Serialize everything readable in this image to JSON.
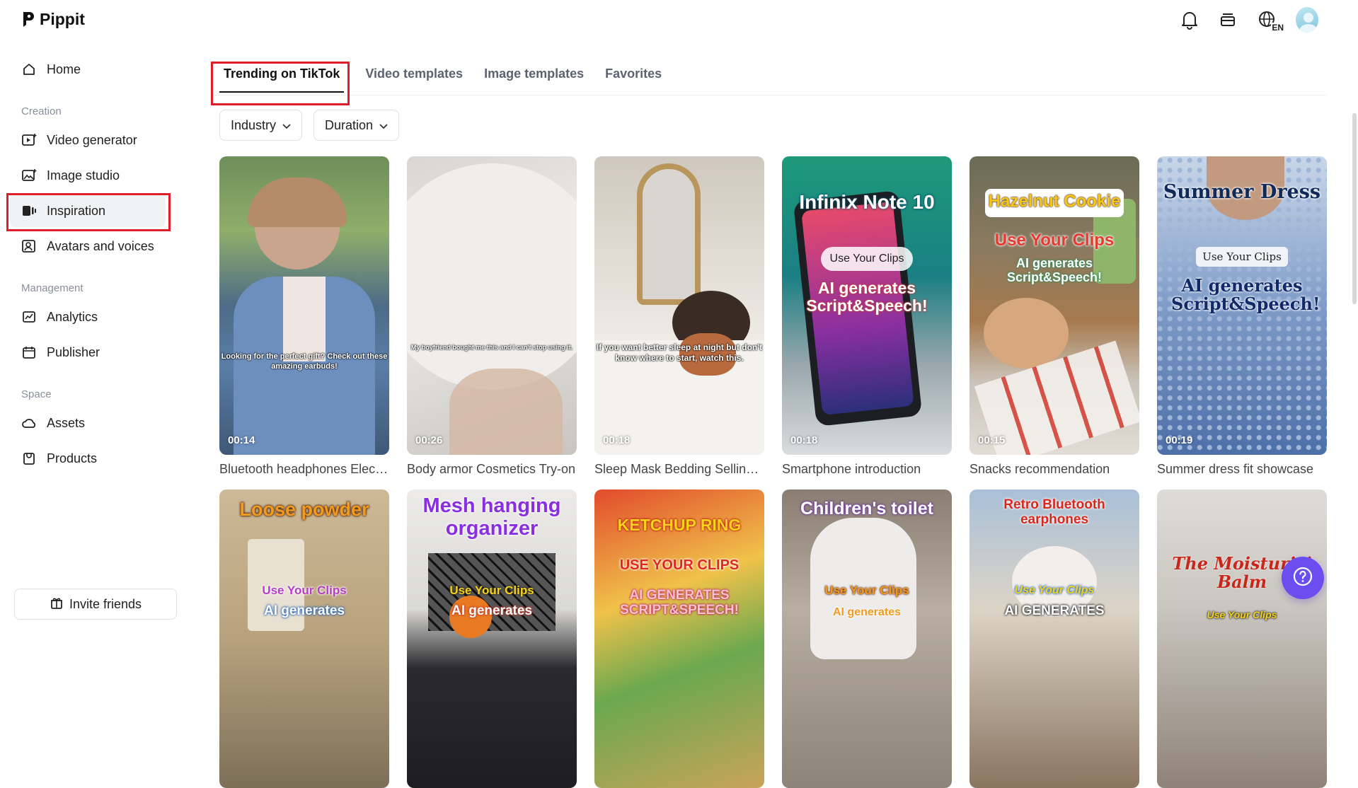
{
  "brand": {
    "name": "Pippit"
  },
  "sidebar": {
    "home": "Home",
    "sections": {
      "creation": "Creation",
      "management": "Management",
      "space": "Space"
    },
    "items": [
      {
        "label": "Video generator"
      },
      {
        "label": "Image studio"
      },
      {
        "label": "Inspiration"
      },
      {
        "label": "Avatars and voices"
      },
      {
        "label": "Analytics"
      },
      {
        "label": "Publisher"
      },
      {
        "label": "Assets"
      },
      {
        "label": "Products"
      }
    ],
    "invite": "Invite friends"
  },
  "header": {
    "language": "EN"
  },
  "tabs": [
    {
      "label": "Trending on TikTok"
    },
    {
      "label": "Video templates"
    },
    {
      "label": "Image templates"
    },
    {
      "label": "Favorites"
    }
  ],
  "filters": {
    "industry": "Industry",
    "duration": "Duration"
  },
  "cards": [
    {
      "duration": "00:14",
      "caption": "Bluetooth headphones Electronics Ad",
      "overlay": "Looking for the perfect gift? Check out these amazing earbuds!"
    },
    {
      "duration": "00:26",
      "caption": "Body armor Cosmetics Try-on",
      "overlay": "My boyfriend bought me this and I can't stop using it."
    },
    {
      "duration": "00:18",
      "caption": "Sleep Mask Bedding Selling Points",
      "overlay": "If you want better sleep at night but don't know where to start, watch this."
    },
    {
      "duration": "00:18",
      "caption": "Smartphone introduction",
      "title": "Infinix Note 10",
      "pill": "Use Your Clips",
      "sub": "AI generates Script&Speech!"
    },
    {
      "duration": "00:15",
      "caption": "Snacks recommendation",
      "title": "Hazelnut Cookie",
      "pill": "Use Your Clips",
      "sub": "AI generates Script&Speech!"
    },
    {
      "duration": "00:19",
      "caption": "Summer dress fit showcase",
      "title": "Summer Dress",
      "pill": "Use Your Clips",
      "sub": "AI generates Script&Speech!"
    }
  ],
  "cards_row2": [
    {
      "title": "Loose powder",
      "pill": "Use Your Clips",
      "sub": "AI generates"
    },
    {
      "title": "Mesh hanging organizer",
      "pill": "Use Your Clips",
      "sub": "AI generates"
    },
    {
      "title": "KETCHUP RING",
      "pill": "USE YOUR CLIPS",
      "sub": "AI GENERATES SCRIPT&SPEECH!"
    },
    {
      "title": "Children's toilet",
      "pill": "Use Your Clips",
      "sub": "AI generates"
    },
    {
      "title": "Retro Bluetooth earphones",
      "pill": "Use Your Clips",
      "sub": "AI GENERATES"
    },
    {
      "title": "The Moisturizi Balm",
      "pill": "Use Your Clips"
    }
  ]
}
